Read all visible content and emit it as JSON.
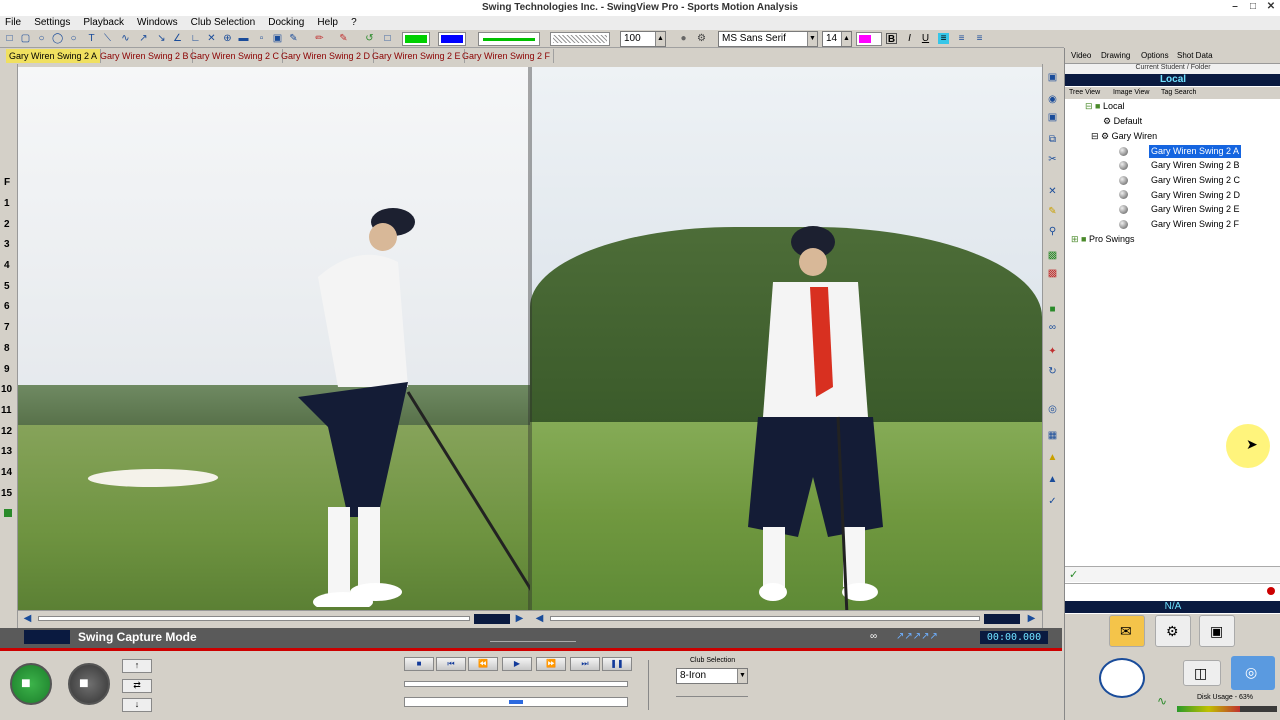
{
  "window": {
    "title": "Swing Technologies Inc. - SwingView Pro - Sports Motion Analysis"
  },
  "menu": [
    "File",
    "Settings",
    "Playback",
    "Windows",
    "Club Selection",
    "Docking",
    "Help",
    "?"
  ],
  "toolbar": {
    "zoom": "100",
    "font": "MS Sans Serif",
    "font_size": "14"
  },
  "clip_tabs": [
    "Gary Wiren Swing 2 A",
    "Gary Wiren Swing 2 B",
    "Gary Wiren Swing 2 C",
    "Gary Wiren Swing 2 D",
    "Gary Wiren Swing 2 E",
    "Gary Wiren Swing 2 F"
  ],
  "ruler": [
    "F",
    "1",
    "2",
    "3",
    "4",
    "5",
    "6",
    "7",
    "8",
    "9",
    "10",
    "11",
    "12",
    "13",
    "14",
    "15"
  ],
  "status": {
    "mode": "Swing Capture Mode",
    "timecode": "00:00.000"
  },
  "club": {
    "label": "Club Selection",
    "value": "8-Iron"
  },
  "right_panel": {
    "tabs": [
      "Video",
      "Drawing",
      "Options",
      "Shot Data"
    ],
    "current_label": "Current Student / Folder",
    "location": "Local",
    "view_tabs": [
      "Tree View",
      "Image View",
      "Tag Search"
    ],
    "tree": {
      "root": "Local",
      "default": "Default",
      "student": "Gary Wiren",
      "swings": [
        "Gary Wiren Swing 2 A",
        "Gary Wiren Swing 2 B",
        "Gary Wiren Swing 2 C",
        "Gary Wiren Swing 2 D",
        "Gary Wiren Swing 2 E",
        "Gary Wiren Swing 2 F"
      ],
      "pro": "Pro Swings"
    },
    "na": "N/A",
    "disk": "Disk Usage - 63%"
  }
}
